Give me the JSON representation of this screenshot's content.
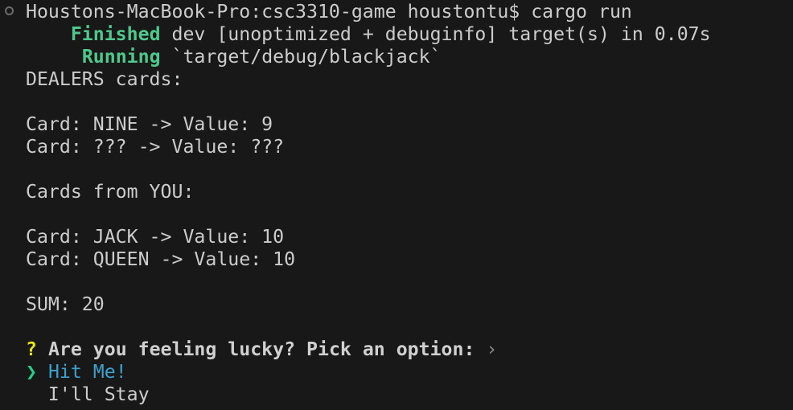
{
  "prompt": {
    "host": "Houstons-MacBook-Pro:csc3310-game houstontu$",
    "command": "cargo run"
  },
  "build": {
    "finished_label": "Finished",
    "finished_text": "dev [unoptimized + debuginfo] target(s) in 0.07s",
    "running_label": "Running",
    "running_text": "`target/debug/blackjack`"
  },
  "dealer": {
    "header": "DEALERS cards:",
    "cards": [
      "Card: NINE -> Value: 9",
      "Card: ??? -> Value: ???"
    ]
  },
  "player": {
    "header": "Cards from YOU:",
    "cards": [
      "Card: JACK -> Value: 10",
      "Card: QUEEN -> Value: 10"
    ],
    "sum": "SUM: 20"
  },
  "question": {
    "mark": "?",
    "text": "Are you feeling lucky? Pick an option:",
    "hint": "›",
    "pointer": "❯",
    "options": [
      "Hit Me!",
      "I'll Stay"
    ]
  }
}
